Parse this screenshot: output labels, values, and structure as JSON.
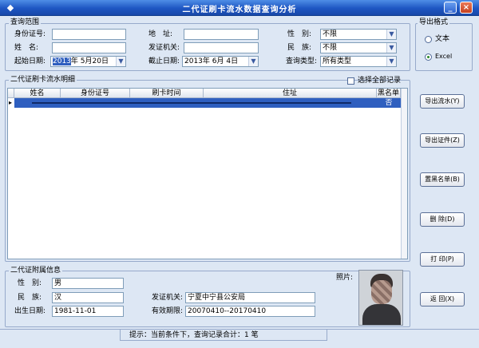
{
  "window": {
    "title": "二代证刷卡流水数据查询分析"
  },
  "query": {
    "legend": "查询范围",
    "id_label": "身份证号:",
    "id_value": "",
    "address_label": "地　址:",
    "address_value": "",
    "gender_label": "性　别:",
    "gender_value": "不限",
    "name_label": "姓　名:",
    "name_value": "",
    "authority_label": "发证机关:",
    "authority_value": "",
    "ethnicity_label": "民　族:",
    "ethnicity_value": "不限",
    "start_label": "起始日期:",
    "start_year": "2013",
    "start_rest": "年 5月20日",
    "end_label": "截止日期:",
    "end_value": "2013年 6月 4日",
    "type_label": "查询类型:",
    "type_value": "所有类型"
  },
  "export_format": {
    "legend": "导出格式",
    "text_label": "文本",
    "excel_label": "Excel",
    "selected": "Excel"
  },
  "detail": {
    "legend": "二代证刷卡流水明细",
    "select_all_label": "选择全部记录",
    "columns": [
      "姓名",
      "身份证号",
      "刷卡时间",
      "住址",
      "黑名单"
    ],
    "rows": [
      {
        "blacklist": "否"
      }
    ]
  },
  "buttons": {
    "export_flow": "导出流水(Y)",
    "export_cert": "导出证件(Z)",
    "blacklist": "置黑名单(B)",
    "delete": "删 除(D)",
    "print": "打 印(P)",
    "back": "返 回(X)"
  },
  "extra": {
    "legend": "二代证附属信息",
    "gender_label": "性　别:",
    "gender_value": "男",
    "ethnicity_label": "民　族:",
    "ethnicity_value": "汉",
    "birth_label": "出生日期:",
    "birth_value": "1981-11-01",
    "authority_label": "发证机关:",
    "authority_value": "宁夏中宁县公安局",
    "validity_label": "有效期限:",
    "validity_value": "20070410--20170410",
    "photo_label": "照片:"
  },
  "status": {
    "text": "提示：当前条件下，查询记录合计：1 笔"
  },
  "colors": {
    "titlebar": "#1e56c2",
    "selection": "#2f5fbf",
    "background": "#dde7f4"
  }
}
